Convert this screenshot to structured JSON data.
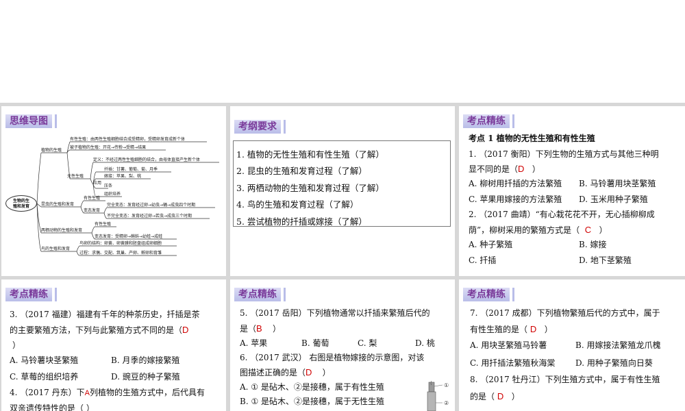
{
  "panel1": {
    "tag": "思维导图",
    "mindmap": {
      "root_line1": "生物的生",
      "root_line2": "殖和发育",
      "plant": "植物的生殖",
      "sexual": "有性生殖：由两性生殖细胞结合成受精卵，受精卵发育成新个体",
      "seed": "被子植物的生殖：开花→传粉→受精→结果",
      "asexual": "无性生殖",
      "def": "定义：不经过两性生殖细胞的结合，由母体直接产生新个体",
      "cut": "扦插：甘薯、葡萄、菊、月季",
      "graft": "嫁接：苹果、梨、桃",
      "apply": "应用",
      "layer": "压条",
      "tissue": "组织培养",
      "insect": "昆虫的生殖和发育",
      "insect_sex": "有性生殖",
      "meta": "变态发育",
      "complete": "完全变态：发育经过卵→幼虫→蛹→成虫四个时期",
      "incomplete": "不完全变态：发育经过卵→若虫→成虫三个时期",
      "amphibian": "两栖动物的生殖和发育",
      "amph_sex": "有性生殖",
      "amph_meta": "变态发育：受精卵→蝌蚪→幼蛙→成蛙",
      "bird": "鸟的生殖和发育",
      "egg": "鸟卵的结构：卵黄、卵黄膜和胚盘组成卵细胞",
      "process": "过程：求偶、交配、筑巢、产卵、孵卵和育雏"
    }
  },
  "panel2": {
    "tag": "考纲要求",
    "items": [
      "1. 植物的无性生殖和有性生殖（了解）",
      "2. 昆虫的生殖和发育过程（了解）",
      "3. 两栖动物的生殖和发育过程（了解）",
      "4. 鸟的生殖和发育过程（了解）",
      "5. 尝试植物的扦插或嫁接（了解）"
    ]
  },
  "panel3": {
    "tag": "考点精练",
    "heading": "考点 1   植物的无性生殖和有性生殖",
    "q1_line1": "1. （2017 衡阳）下列生物的生殖方式与其他三种明",
    "q1_line2": "显不同的是（",
    "q1_ans": "D",
    "q1_close": "）",
    "q1_a": "A. 柳树用扦插的方法繁殖",
    "q1_b": "B. 马铃薯用块茎繁殖",
    "q1_c": "C. 苹果用嫁接的方法繁殖",
    "q1_d": "D. 玉米用种子繁殖",
    "q2_line1": "2. （2017 曲靖）“有心栽花花不开，无心插柳柳成",
    "q2_line2": "荫”，柳树采用的繁殖方式是（",
    "q2_ans": "C",
    "q2_close": "）",
    "q2_a": "A. 种子繁殖",
    "q2_b": "B. 嫁接",
    "q2_c": "C. 扦插",
    "q2_d": "D. 地下茎繁殖"
  },
  "panel4": {
    "tag": "考点精练",
    "q3_line1": "3. （2017 福建）福建有千年的种茶历史，扦插是茶",
    "q3_line2": "的主要繁殖方法，下列与此繁殖方式不同的是（",
    "q3_ans": "D",
    "q3_line3": "）",
    "q3_a": "A. 马铃薯块茎繁殖",
    "q3_b": "B. 月季的嫁接繁殖",
    "q3_c": "C. 草莓的组织培养",
    "q3_d": "D. 豌豆的种子繁殖",
    "q4_pre": "4. （2017 丹东）下",
    "q4_ans": "A",
    "q4_post": "列植物的生殖方式中，后代具有",
    "q4_line2": "双亲遗传特性的是（          ）"
  },
  "panel5": {
    "tag": "考点精练",
    "q5_line1": "5. （2017 岳阳）下列植物通常以扦插来繁殖后代的",
    "q5_line2": "是（",
    "q5_ans": "B",
    "q5_close": "）",
    "q5_a": "A. 苹果",
    "q5_b": "B. 葡萄",
    "q5_c": "C. 梨",
    "q5_d": "D. 桃",
    "q6_line1": "6. （2017 武汉）  右图是植物嫁接的示意图，对该",
    "q6_line2": "图描述正确的是（",
    "q6_ans": "D",
    "q6_close": "）",
    "q6_a": "A. ① 是砧木、②是接穗，属于有性生殖",
    "q6_b": "B. ① 是砧木、②是接穗，属于无性生殖",
    "fig_1": "①",
    "fig_2": "②"
  },
  "panel6": {
    "tag": "考点精练",
    "q7_line1": "7. （2017 成都）下列植物繁殖后代的方式中，属于",
    "q7_line2": "有性生殖的是（",
    "q7_ans": "D",
    "q7_close": "）",
    "q7_a": "A. 用块茎繁殖马铃薯",
    "q7_b": "B. 用嫁接法繁殖龙爪槐",
    "q7_c": "C. 用扦插法繁殖秋海棠",
    "q7_d": "D. 用种子繁殖向日葵",
    "q8_line1": "8. （2017 牡丹江）下列生殖方式中，属于有性生殖",
    "q8_line2": "的是（",
    "q8_ans": "D",
    "q8_close": "）"
  }
}
